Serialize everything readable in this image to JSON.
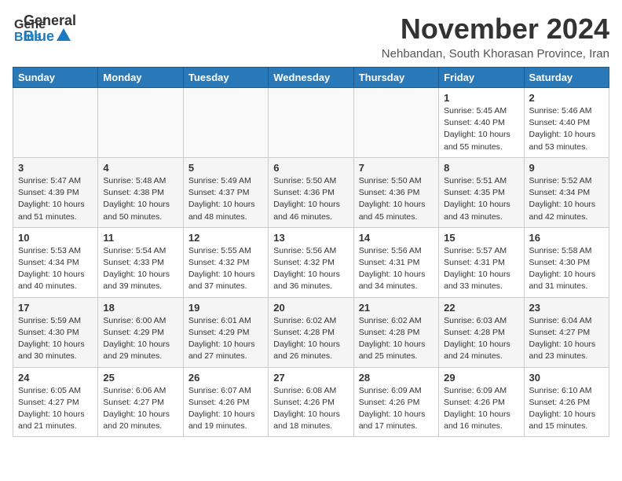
{
  "header": {
    "logo_general": "General",
    "logo_blue": "Blue",
    "month_title": "November 2024",
    "subtitle": "Nehbandan, South Khorasan Province, Iran"
  },
  "weekdays": [
    "Sunday",
    "Monday",
    "Tuesday",
    "Wednesday",
    "Thursday",
    "Friday",
    "Saturday"
  ],
  "weeks": [
    [
      {
        "day": "",
        "info": ""
      },
      {
        "day": "",
        "info": ""
      },
      {
        "day": "",
        "info": ""
      },
      {
        "day": "",
        "info": ""
      },
      {
        "day": "",
        "info": ""
      },
      {
        "day": "1",
        "info": "Sunrise: 5:45 AM\nSunset: 4:40 PM\nDaylight: 10 hours\nand 55 minutes."
      },
      {
        "day": "2",
        "info": "Sunrise: 5:46 AM\nSunset: 4:40 PM\nDaylight: 10 hours\nand 53 minutes."
      }
    ],
    [
      {
        "day": "3",
        "info": "Sunrise: 5:47 AM\nSunset: 4:39 PM\nDaylight: 10 hours\nand 51 minutes."
      },
      {
        "day": "4",
        "info": "Sunrise: 5:48 AM\nSunset: 4:38 PM\nDaylight: 10 hours\nand 50 minutes."
      },
      {
        "day": "5",
        "info": "Sunrise: 5:49 AM\nSunset: 4:37 PM\nDaylight: 10 hours\nand 48 minutes."
      },
      {
        "day": "6",
        "info": "Sunrise: 5:50 AM\nSunset: 4:36 PM\nDaylight: 10 hours\nand 46 minutes."
      },
      {
        "day": "7",
        "info": "Sunrise: 5:50 AM\nSunset: 4:36 PM\nDaylight: 10 hours\nand 45 minutes."
      },
      {
        "day": "8",
        "info": "Sunrise: 5:51 AM\nSunset: 4:35 PM\nDaylight: 10 hours\nand 43 minutes."
      },
      {
        "day": "9",
        "info": "Sunrise: 5:52 AM\nSunset: 4:34 PM\nDaylight: 10 hours\nand 42 minutes."
      }
    ],
    [
      {
        "day": "10",
        "info": "Sunrise: 5:53 AM\nSunset: 4:34 PM\nDaylight: 10 hours\nand 40 minutes."
      },
      {
        "day": "11",
        "info": "Sunrise: 5:54 AM\nSunset: 4:33 PM\nDaylight: 10 hours\nand 39 minutes."
      },
      {
        "day": "12",
        "info": "Sunrise: 5:55 AM\nSunset: 4:32 PM\nDaylight: 10 hours\nand 37 minutes."
      },
      {
        "day": "13",
        "info": "Sunrise: 5:56 AM\nSunset: 4:32 PM\nDaylight: 10 hours\nand 36 minutes."
      },
      {
        "day": "14",
        "info": "Sunrise: 5:56 AM\nSunset: 4:31 PM\nDaylight: 10 hours\nand 34 minutes."
      },
      {
        "day": "15",
        "info": "Sunrise: 5:57 AM\nSunset: 4:31 PM\nDaylight: 10 hours\nand 33 minutes."
      },
      {
        "day": "16",
        "info": "Sunrise: 5:58 AM\nSunset: 4:30 PM\nDaylight: 10 hours\nand 31 minutes."
      }
    ],
    [
      {
        "day": "17",
        "info": "Sunrise: 5:59 AM\nSunset: 4:30 PM\nDaylight: 10 hours\nand 30 minutes."
      },
      {
        "day": "18",
        "info": "Sunrise: 6:00 AM\nSunset: 4:29 PM\nDaylight: 10 hours\nand 29 minutes."
      },
      {
        "day": "19",
        "info": "Sunrise: 6:01 AM\nSunset: 4:29 PM\nDaylight: 10 hours\nand 27 minutes."
      },
      {
        "day": "20",
        "info": "Sunrise: 6:02 AM\nSunset: 4:28 PM\nDaylight: 10 hours\nand 26 minutes."
      },
      {
        "day": "21",
        "info": "Sunrise: 6:02 AM\nSunset: 4:28 PM\nDaylight: 10 hours\nand 25 minutes."
      },
      {
        "day": "22",
        "info": "Sunrise: 6:03 AM\nSunset: 4:28 PM\nDaylight: 10 hours\nand 24 minutes."
      },
      {
        "day": "23",
        "info": "Sunrise: 6:04 AM\nSunset: 4:27 PM\nDaylight: 10 hours\nand 23 minutes."
      }
    ],
    [
      {
        "day": "24",
        "info": "Sunrise: 6:05 AM\nSunset: 4:27 PM\nDaylight: 10 hours\nand 21 minutes."
      },
      {
        "day": "25",
        "info": "Sunrise: 6:06 AM\nSunset: 4:27 PM\nDaylight: 10 hours\nand 20 minutes."
      },
      {
        "day": "26",
        "info": "Sunrise: 6:07 AM\nSunset: 4:26 PM\nDaylight: 10 hours\nand 19 minutes."
      },
      {
        "day": "27",
        "info": "Sunrise: 6:08 AM\nSunset: 4:26 PM\nDaylight: 10 hours\nand 18 minutes."
      },
      {
        "day": "28",
        "info": "Sunrise: 6:09 AM\nSunset: 4:26 PM\nDaylight: 10 hours\nand 17 minutes."
      },
      {
        "day": "29",
        "info": "Sunrise: 6:09 AM\nSunset: 4:26 PM\nDaylight: 10 hours\nand 16 minutes."
      },
      {
        "day": "30",
        "info": "Sunrise: 6:10 AM\nSunset: 4:26 PM\nDaylight: 10 hours\nand 15 minutes."
      }
    ]
  ]
}
